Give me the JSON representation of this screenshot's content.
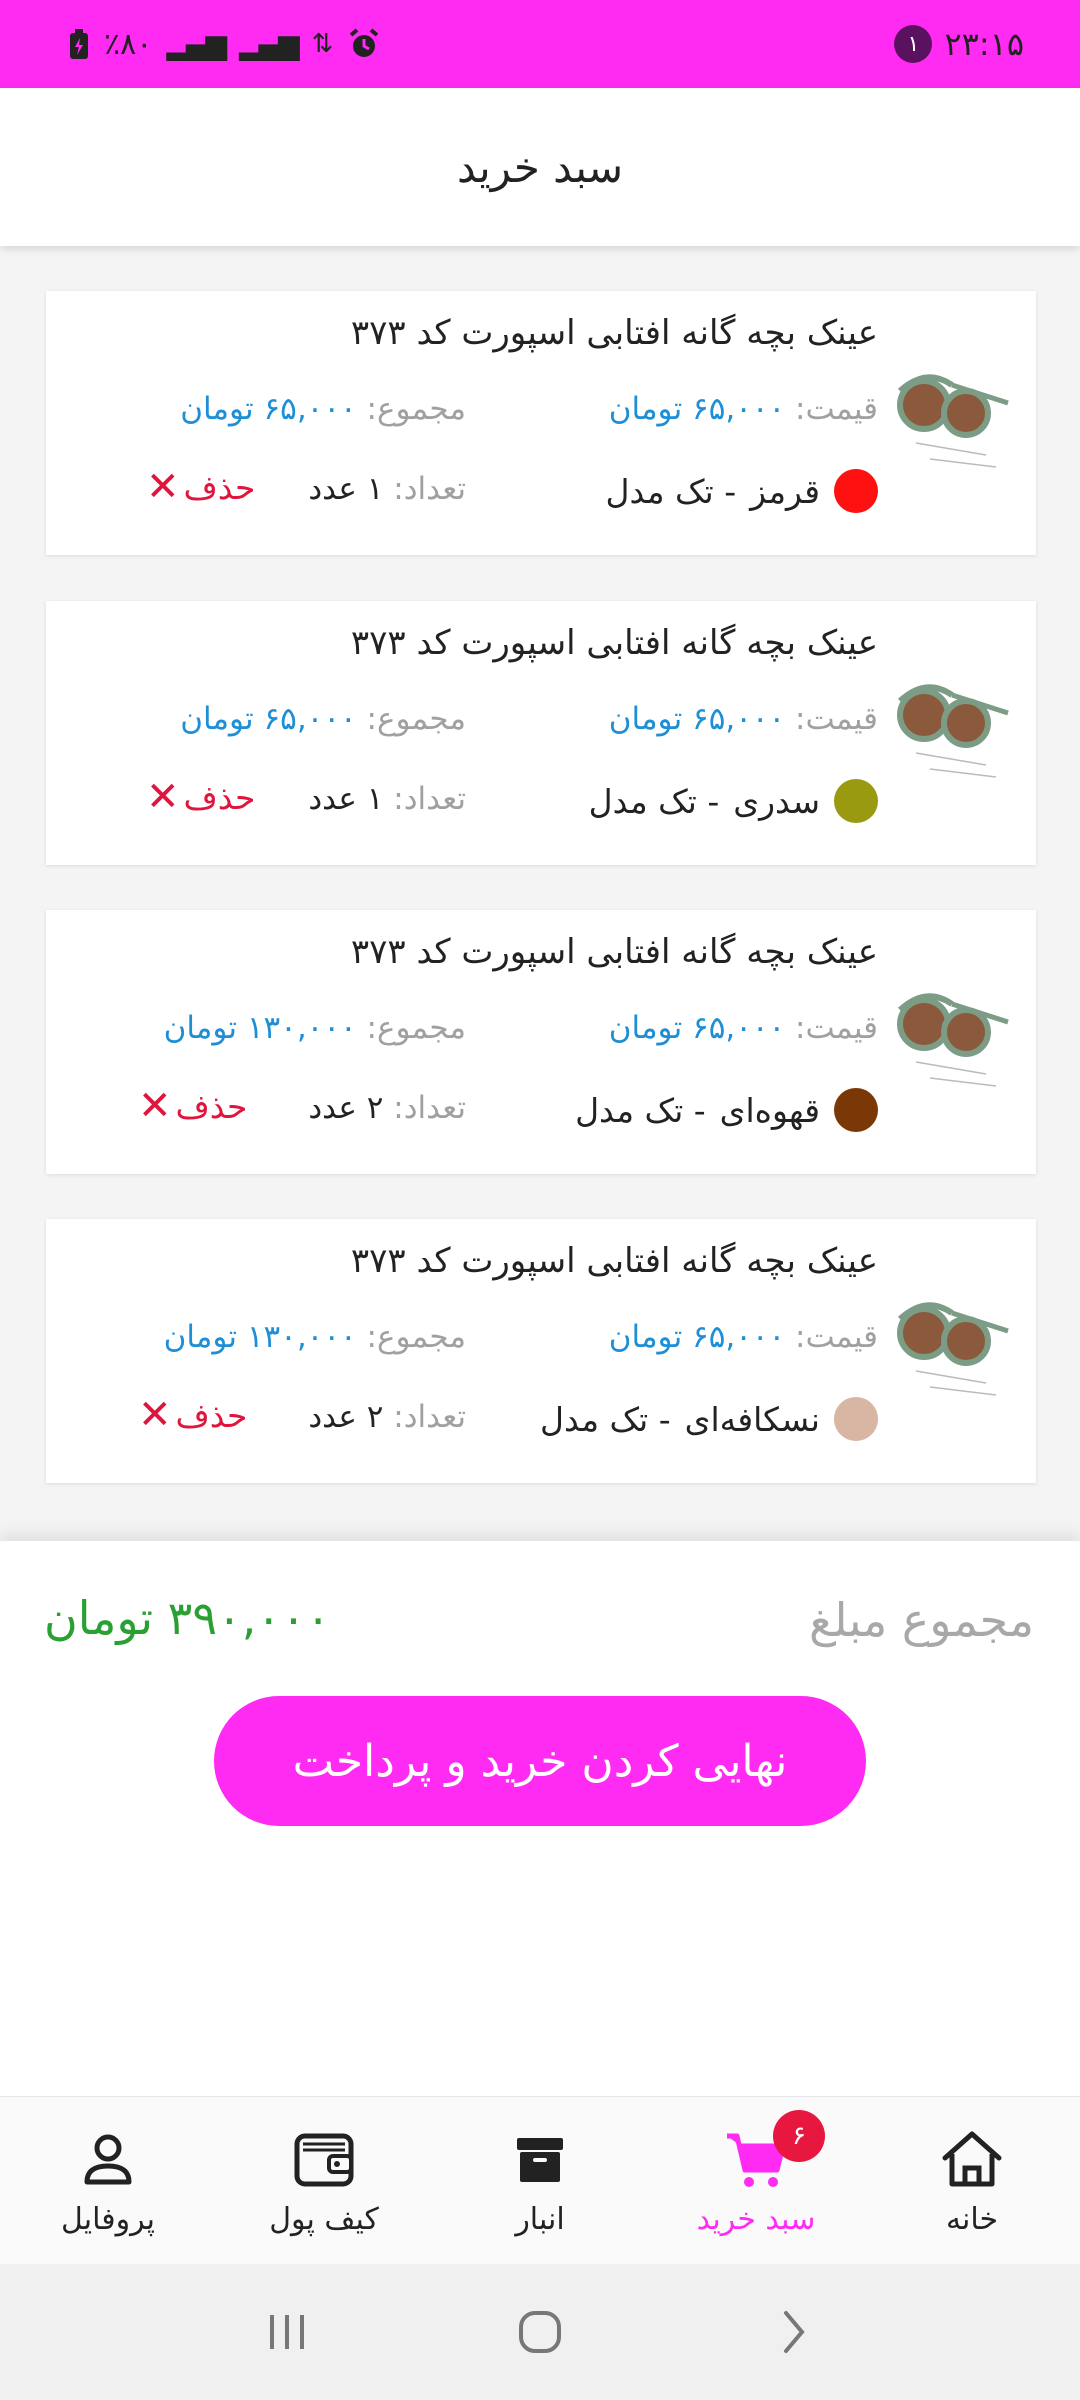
{
  "status_bar": {
    "time": "۲۳:۱۵",
    "notification_count": "۱",
    "battery": "٪۸۰"
  },
  "app_bar": {
    "title": "سبد خرید"
  },
  "labels": {
    "price": "قیمت:",
    "total": "مجموع:",
    "quantity": "تعداد:",
    "delete": "حذف",
    "model_sep": "-  تک مدل"
  },
  "cart_items": [
    {
      "title": "عینک بچه گانه افتابی اسپورت کد ۳۷۳",
      "price": "۶۵,۰۰۰ تومان",
      "total": "۶۵,۰۰۰ تومان",
      "color_name": "قرمز",
      "color_hex": "#ff1010",
      "quantity": "۱ عدد"
    },
    {
      "title": "عینک بچه گانه افتابی اسپورت کد ۳۷۳",
      "price": "۶۵,۰۰۰ تومان",
      "total": "۶۵,۰۰۰ تومان",
      "color_name": "سدری",
      "color_hex": "#9a9a10",
      "quantity": "۱ عدد"
    },
    {
      "title": "عینک بچه گانه افتابی اسپورت کد ۳۷۳",
      "price": "۶۵,۰۰۰ تومان",
      "total": "۱۳۰,۰۰۰ تومان",
      "color_name": "قهوه‌ای",
      "color_hex": "#7a3806",
      "quantity": "۲ عدد"
    },
    {
      "title": "عینک بچه گانه افتابی اسپورت کد ۳۷۳",
      "price": "۶۵,۰۰۰ تومان",
      "total": "۱۳۰,۰۰۰ تومان",
      "color_name": "نسکافه‌ای",
      "color_hex": "#d9b5a3",
      "quantity": "۲ عدد"
    }
  ],
  "summary": {
    "label": "مجموع مبلغ",
    "total": "۳۹۰,۰۰۰ تومان",
    "checkout_label": "نهایی کردن خرید و پرداخت"
  },
  "bottom_nav": {
    "items": [
      {
        "label": "خانه",
        "icon": "home-icon"
      },
      {
        "label": "سبد خرید",
        "icon": "cart-icon",
        "badge": "۶",
        "active": true
      },
      {
        "label": "انبار",
        "icon": "archive-icon"
      },
      {
        "label": "کیف پول",
        "icon": "wallet-icon"
      },
      {
        "label": "پروفایل",
        "icon": "person-icon"
      }
    ]
  },
  "colors": {
    "accent": "#ff2bf2",
    "price_blue": "#1e8fd6",
    "delete_red": "#e0143c",
    "total_green": "#2aa032"
  }
}
